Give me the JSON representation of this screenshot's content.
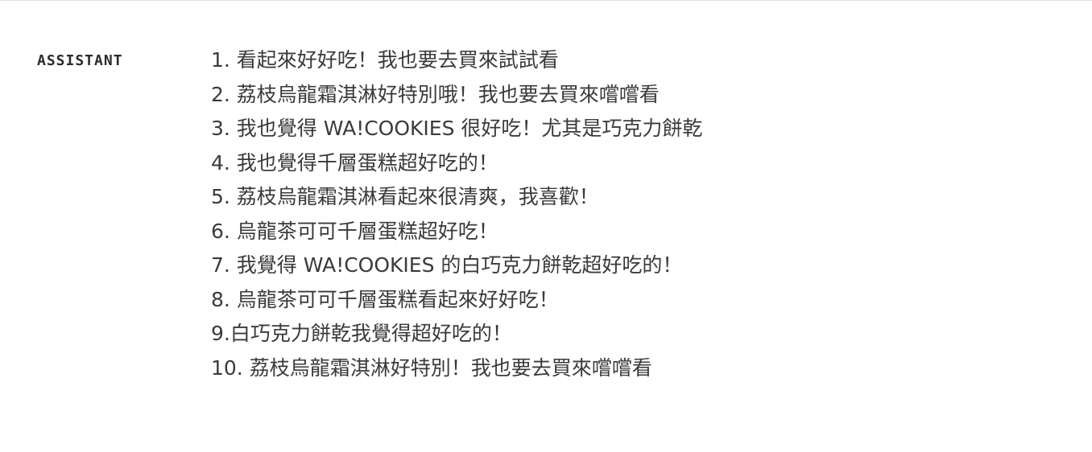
{
  "message": {
    "role": "ASSISTANT",
    "lines": [
      "1. 看起來好好吃！我也要去買來試試看",
      "2. 荔枝烏龍霜淇淋好特別哦！我也要去買來嚐嚐看",
      "3. 我也覺得 WA!COOKIES 很好吃！尤其是巧克力餅乾",
      "4. 我也覺得千層蛋糕超好吃的！",
      "5. 荔枝烏龍霜淇淋看起來很清爽，我喜歡！",
      "6. 烏龍茶可可千層蛋糕超好吃！",
      "7. 我覺得 WA!COOKIES 的白巧克力餅乾超好吃的！",
      "8. 烏龍茶可可千層蛋糕看起來好好吃！",
      "9.白巧克力餅乾我覺得超好吃的！",
      "10. 荔枝烏龍霜淇淋好特別！我也要去買來嚐嚐看"
    ]
  }
}
